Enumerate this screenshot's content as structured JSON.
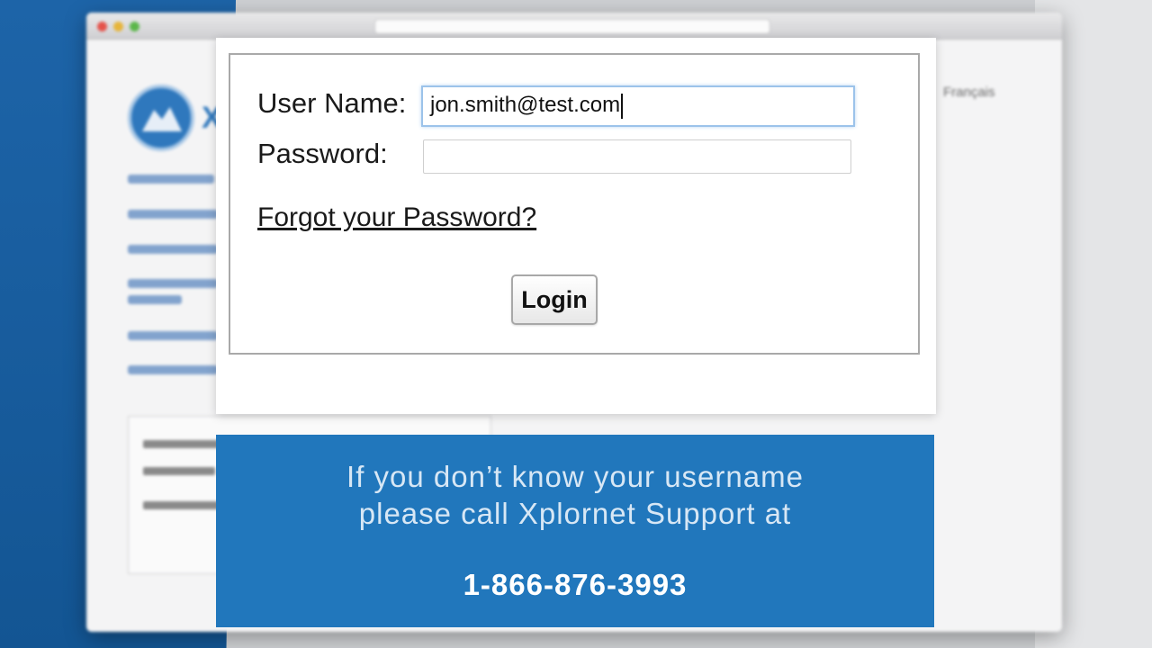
{
  "background": {
    "language_link": "Français"
  },
  "login_form": {
    "username_label": "User Name:",
    "username_value": "jon.smith@test.com",
    "password_label": "Password:",
    "password_value": "",
    "forgot_link": "Forgot your Password?",
    "login_button": "Login"
  },
  "support_banner": {
    "line1": "If you don’t know your username",
    "line2": "please call Xplornet Support at",
    "phone": "1-866-876-3993"
  },
  "colors": {
    "banner_bg": "#2177bc",
    "left_panel": "#1d64a8",
    "input_focus": "#9cc3ea"
  }
}
